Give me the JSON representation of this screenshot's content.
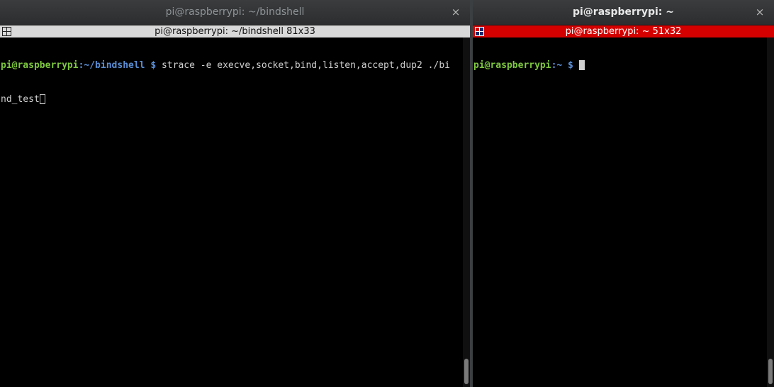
{
  "left_window": {
    "title": "pi@raspberrypi: ~/bindshell",
    "close_glyph": "×",
    "screen_bar": "pi@raspberrypi: ~/bindshell 81x33",
    "screen_icon": "window-grid-icon",
    "prompt_user": "pi@raspberrypi",
    "prompt_path": ":~/bindshell",
    "prompt_dollar": " $ ",
    "command_line1": "strace -e execve,socket,bind,listen,accept,dup2 ./bi",
    "command_line2": "nd_test"
  },
  "right_window": {
    "title": "pi@raspberrypi: ~",
    "close_glyph": "×",
    "screen_bar": "pi@raspberrypi: ~ 51x32",
    "screen_icon": "window-grid-icon",
    "prompt_user": "pi@raspberrypi",
    "prompt_path": ":~",
    "prompt_dollar": " $ "
  },
  "colors": {
    "prompt_user": "#7ec83f",
    "prompt_path": "#5a8fd6",
    "active_screen_bar": "#d40000",
    "inactive_screen_bar": "#d9d9d9"
  }
}
